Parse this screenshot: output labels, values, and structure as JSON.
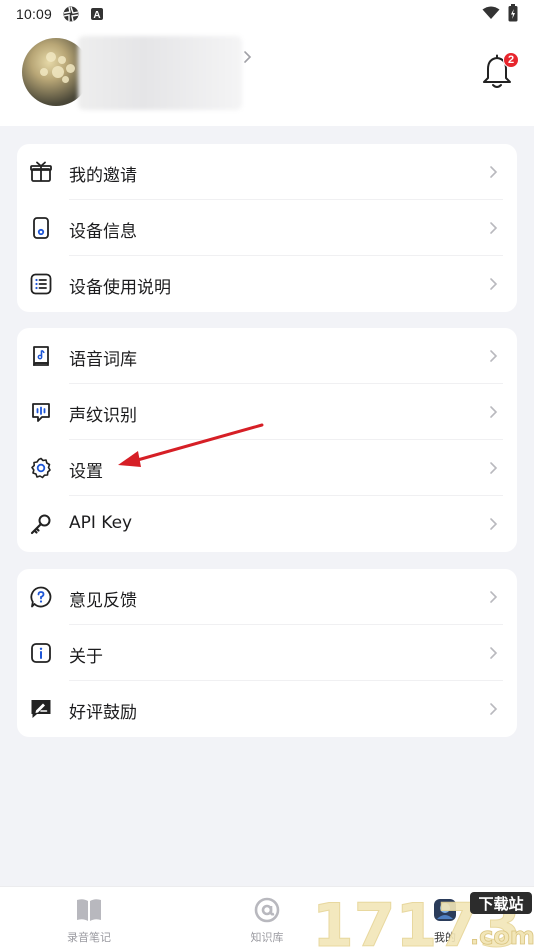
{
  "status_bar": {
    "time": "10:09",
    "battery_icon": "battery-charging-icon",
    "wifi_icon": "wifi-icon"
  },
  "header": {
    "notification_count": "2"
  },
  "menu_groups": [
    {
      "items": [
        {
          "label": "我的邀请",
          "icon": "gift-icon"
        },
        {
          "label": "设备信息",
          "icon": "device-icon"
        },
        {
          "label": "设备使用说明",
          "icon": "list-icon"
        }
      ]
    },
    {
      "items": [
        {
          "label": "语音词库",
          "icon": "music-book-icon"
        },
        {
          "label": "声纹识别",
          "icon": "voiceprint-icon"
        },
        {
          "label": "设置",
          "icon": "gear-icon"
        },
        {
          "label": "API Key",
          "icon": "key-icon"
        }
      ]
    },
    {
      "items": [
        {
          "label": "意见反馈",
          "icon": "question-icon"
        },
        {
          "label": "关于",
          "icon": "info-icon"
        },
        {
          "label": "好评鼓励",
          "icon": "rate-icon"
        }
      ]
    }
  ],
  "tabbar": {
    "tabs": [
      {
        "label": "录音笔记",
        "icon": "book-icon"
      },
      {
        "label": "知识库",
        "icon": "at-icon"
      },
      {
        "label": "我的",
        "icon": "profile-icon"
      }
    ]
  },
  "watermark": {
    "text": "17173",
    "badge": "下载站",
    "domain": ".com"
  },
  "colors": {
    "accent": "#1e56d6",
    "arrow": "#d61f26",
    "badge": "#e7262d"
  }
}
